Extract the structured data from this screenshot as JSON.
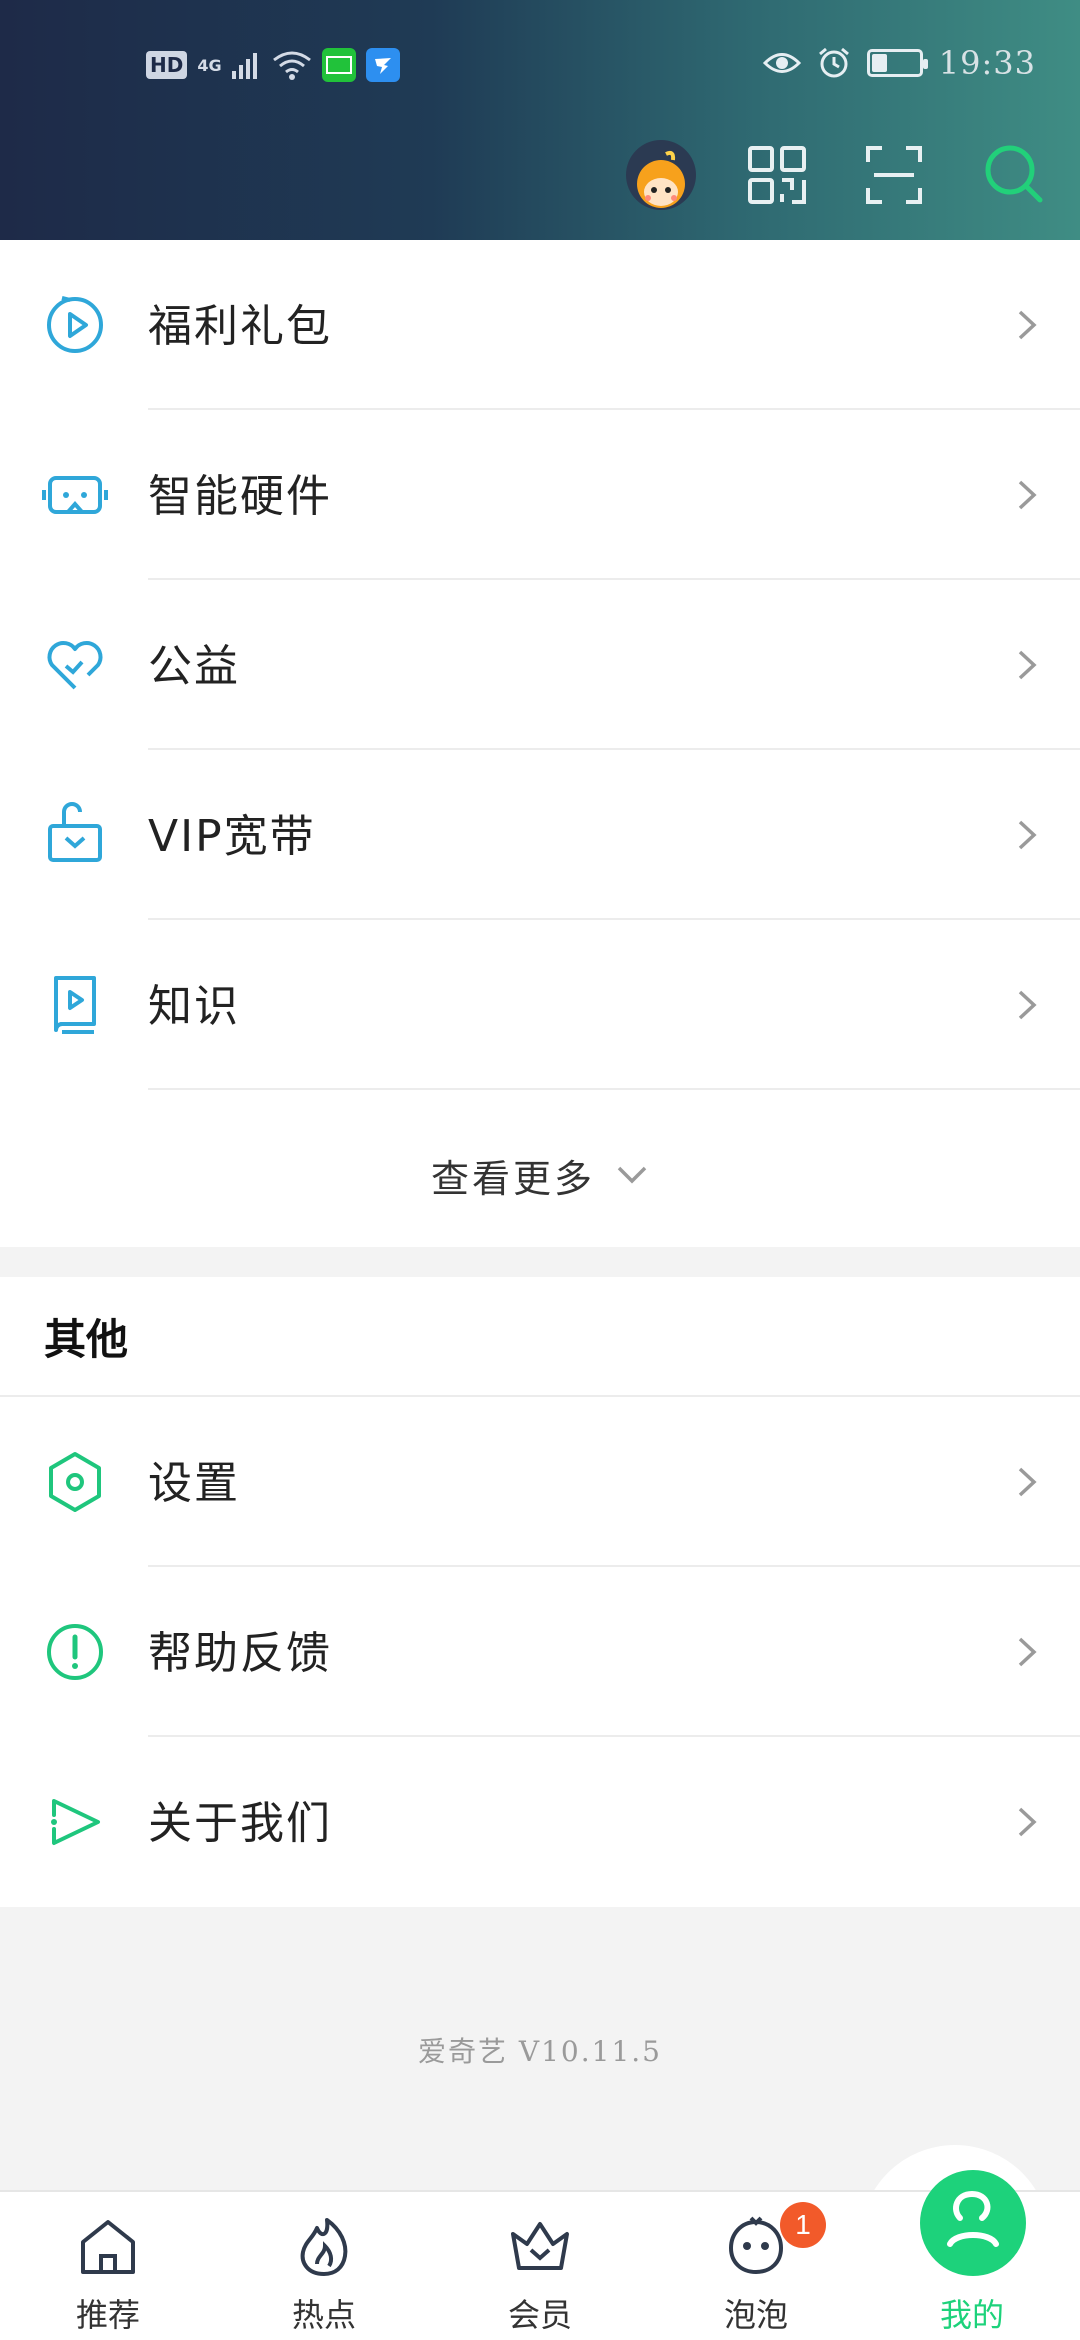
{
  "status_bar": {
    "hd": "HD",
    "network": "4G",
    "time": "19:33"
  },
  "header": {
    "icons": [
      "avatar",
      "qr-code-icon",
      "scan-icon",
      "search-icon"
    ]
  },
  "services": {
    "items": [
      {
        "label": "福利礼包",
        "icon": "play-circle-icon"
      },
      {
        "label": "智能硬件",
        "icon": "vr-headset-icon"
      },
      {
        "label": "公益",
        "icon": "heart-icon"
      },
      {
        "label": "VIP宽带",
        "icon": "router-icon"
      },
      {
        "label": "知识",
        "icon": "book-icon"
      }
    ],
    "more_label": "查看更多"
  },
  "other": {
    "title": "其他",
    "items": [
      {
        "label": "设置",
        "icon": "settings-icon"
      },
      {
        "label": "帮助反馈",
        "icon": "help-icon"
      },
      {
        "label": "关于我们",
        "icon": "play-logo-icon"
      }
    ]
  },
  "version": "爱奇艺 V10.11.5",
  "tabs": [
    {
      "label": "推荐",
      "icon": "home-icon"
    },
    {
      "label": "热点",
      "icon": "flame-icon"
    },
    {
      "label": "会员",
      "icon": "crown-icon"
    },
    {
      "label": "泡泡",
      "icon": "bubble-icon",
      "badge": "1"
    },
    {
      "label": "我的",
      "icon": "user-icon",
      "active": true
    }
  ],
  "colors": {
    "accent": "#1dd27b",
    "blue_icon": "#2fa7d9",
    "green_icon": "#1fc67d"
  }
}
